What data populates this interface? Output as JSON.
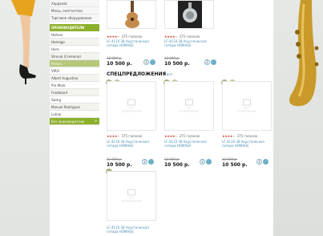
{
  "sidebar": {
    "top_items": [
      {
        "label": "Хардкейс"
      },
      {
        "label": "Мелы, смягчители"
      },
      {
        "label": "Торговое оборудование"
      }
    ],
    "brand_header": "ПРОИЗВОДИТЕЛИ",
    "brands": [
      {
        "label": "Hohner"
      },
      {
        "label": "Homage"
      },
      {
        "label": "Hora"
      },
      {
        "label": "Strunal (Cremona)"
      },
      {
        "label": "Parkes"
      },
      {
        "label": "VIRO"
      },
      {
        "label": "Albert Augustino"
      },
      {
        "label": "Pro-Mark"
      },
      {
        "label": "Freeboard"
      },
      {
        "label": "Swing"
      },
      {
        "label": "Manuel Rodriguez"
      },
      {
        "label": "Lutner"
      }
    ],
    "all_brands": "Все производители",
    "all_brands_arrow": "»"
  },
  "top_products": [
    {
      "votes": "375 голосов",
      "name": "LF-4110 38 Акустическая гитара HOMAGE",
      "old_price": "12 000 р.",
      "price": "10 500 р.",
      "qty": "2"
    },
    {
      "votes": "375 голосов",
      "name": "LF-4110 38 Акустическая гитара HOMAGE",
      "old_price": "12 000 р.",
      "price": "10 500 р.",
      "qty": "2"
    }
  ],
  "specials": {
    "title": "СПЕЦПРЕДЛОЖЕНИЯ",
    "link": "все",
    "no_photo_text": "НЕТ ИЗОБРАЖЕНИЯ",
    "products": [
      {
        "votes": "375 голосов",
        "name": "LF-4110 38 Акустическая гитара HOMAGE",
        "old_price": "12 000 р.",
        "price": "10 500 р.",
        "qty": "2"
      },
      {
        "votes": "375 голосов",
        "name": "LF-4110 38 Акустическая гитара HOMAGE",
        "old_price": "12 000 р.",
        "price": "10 500 р.",
        "qty": "2"
      },
      {
        "votes": "375 голосов",
        "name": "LF-4110 38 Акустическая гитара HOMAGE",
        "old_price": "12 000 р.",
        "price": "10 500 р.",
        "qty": "2"
      },
      {
        "name": "LF-4110 38 Акустическая гитара HOMAGE"
      }
    ]
  },
  "colors": {
    "accent_green": "#8db02c",
    "link_blue": "#4b8fb5",
    "star_red": "#c0392b"
  }
}
